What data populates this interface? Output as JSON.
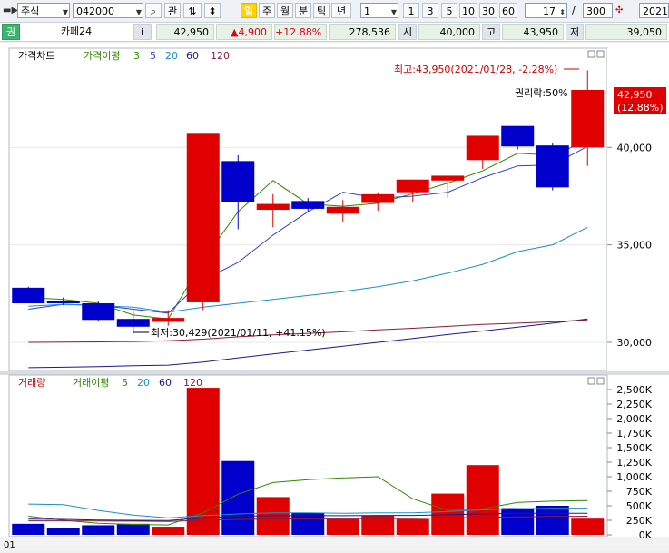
{
  "toolbar": {
    "market": "주식",
    "code": "042000",
    "btn_interest": "관",
    "btn_day_active": "일",
    "periods": [
      "주",
      "월",
      "분",
      "틱",
      "년"
    ],
    "interval_value": "1",
    "quick_intervals": [
      "1",
      "3",
      "5",
      "10",
      "30",
      "60"
    ],
    "count_value": "17",
    "slash": "/",
    "total_value": "300",
    "date_value": "2021/"
  },
  "quote": {
    "tag": "권",
    "name": "카페24",
    "info_btn": "i",
    "price": "42,950",
    "change": "▲4,900",
    "change_pct": "+12.88%",
    "volume": "278,536",
    "open_label": "시",
    "open": "40,000",
    "high_label": "고",
    "high": "43,950",
    "low_label": "저",
    "low": "39,050"
  },
  "colors": {
    "up": "#e00000",
    "down": "#0000cc",
    "ma3": "#2e8b00",
    "ma5": "#2f3fd0",
    "ma20": "#1a90c8",
    "ma60": "#1a1a8c",
    "ma120": "#8b1a3c"
  },
  "chart_data": [
    {
      "type": "candlestick",
      "legend": {
        "title": "가격차트",
        "ma_title": "가격이평",
        "periods": [
          "3",
          "5",
          "20",
          "60",
          "120"
        ]
      },
      "y_ticks": [
        "40,000",
        "35,000",
        "30,000"
      ],
      "ylim": [
        28600,
        45000
      ],
      "x_ticks": [
        "01"
      ],
      "candles": [
        {
          "o": 32800,
          "h": 32850,
          "l": 32000,
          "c": 32000
        },
        {
          "o": 32100,
          "h": 32300,
          "l": 31900,
          "c": 32000
        },
        {
          "o": 32000,
          "h": 32100,
          "l": 31100,
          "c": 31150
        },
        {
          "o": 31200,
          "h": 31600,
          "l": 30430,
          "c": 30800
        },
        {
          "o": 31050,
          "h": 31650,
          "l": 30850,
          "c": 31250
        },
        {
          "o": 32050,
          "h": 40700,
          "l": 31650,
          "c": 40700
        },
        {
          "o": 39300,
          "h": 39600,
          "l": 35800,
          "c": 37200
        },
        {
          "o": 36800,
          "h": 37600,
          "l": 35900,
          "c": 37100
        },
        {
          "o": 37250,
          "h": 37400,
          "l": 36700,
          "c": 36850
        },
        {
          "o": 36600,
          "h": 37300,
          "l": 36200,
          "c": 36950
        },
        {
          "o": 37150,
          "h": 37700,
          "l": 36750,
          "c": 37600
        },
        {
          "o": 37700,
          "h": 38350,
          "l": 37200,
          "c": 38350
        },
        {
          "o": 38300,
          "h": 38450,
          "l": 37400,
          "c": 38550
        },
        {
          "o": 39350,
          "h": 40600,
          "l": 38900,
          "c": 40600
        },
        {
          "o": 41100,
          "h": 41100,
          "l": 39900,
          "c": 40050
        },
        {
          "o": 40100,
          "h": 40200,
          "l": 37800,
          "c": 37950
        },
        {
          "o": 40000,
          "h": 43950,
          "l": 39050,
          "c": 42950
        }
      ],
      "ma": {
        "3": [
          32300,
          32200,
          32000,
          31400,
          31200,
          34200,
          36700,
          38300,
          37100,
          36980,
          37130,
          37630,
          38170,
          38800,
          39700,
          39600,
          40350
        ],
        "5": [
          31700,
          31950,
          31900,
          31700,
          31500,
          33200,
          34100,
          35500,
          36700,
          37700,
          37400,
          37500,
          37700,
          38450,
          39050,
          39100,
          40050
        ],
        "20": [
          31850,
          31950,
          31880,
          31800,
          31550,
          31800,
          32000,
          32200,
          32400,
          32600,
          32850,
          33150,
          33550,
          34000,
          34650,
          35000,
          35900
        ],
        "60": [
          28700,
          28720,
          28750,
          28800,
          28830,
          28980,
          29200,
          29400,
          29600,
          29800,
          30000,
          30200,
          30400,
          30580,
          30780,
          30980,
          31200
        ],
        "120": [
          30000,
          30010,
          30020,
          30040,
          30080,
          30160,
          30280,
          30380,
          30460,
          30540,
          30640,
          30720,
          30820,
          30920,
          30980,
          31050,
          31150
        ]
      },
      "annotations": {
        "high": "최고:43,950(2021/01/28, -2.28%)",
        "low": "최저:30,429(2021/01/11, +41.15%)",
        "rights": "권리락:50%"
      },
      "current_label": "42,950",
      "current_pct": "(12.88%)"
    },
    {
      "type": "bar",
      "legend": {
        "title": "거래량",
        "ma_title": "거래이평",
        "periods": [
          "5",
          "20",
          "60",
          "120"
        ]
      },
      "y_ticks": [
        "2,500K",
        "2,250K",
        "2,000K",
        "1,750K",
        "1,500K",
        "1,250K",
        "1,000K",
        "750K",
        "500K",
        "250K",
        "0K"
      ],
      "ylim": [
        0,
        2500000
      ],
      "values": [
        190000,
        125000,
        165000,
        190000,
        140000,
        2530000,
        1270000,
        650000,
        380000,
        270000,
        330000,
        270000,
        710000,
        1200000,
        460000,
        500000,
        278536
      ],
      "ma": {
        "5": [
          320000,
          250000,
          200000,
          180000,
          170000,
          380000,
          700000,
          900000,
          950000,
          980000,
          1000000,
          620000,
          420000,
          450000,
          560000,
          580000,
          590000
        ],
        "20": [
          530000,
          520000,
          420000,
          340000,
          290000,
          330000,
          360000,
          380000,
          380000,
          370000,
          380000,
          380000,
          400000,
          430000,
          450000,
          460000,
          460000
        ],
        "60": [
          270000,
          265000,
          255000,
          250000,
          245000,
          290000,
          320000,
          330000,
          330000,
          330000,
          335000,
          335000,
          345000,
          360000,
          370000,
          370000,
          372000
        ],
        "120": [
          240000,
          240000,
          238000,
          236000,
          232000,
          250000,
          265000,
          272000,
          275000,
          277000,
          280000,
          282000,
          290000,
          302000,
          310000,
          316000,
          320000
        ]
      }
    }
  ]
}
